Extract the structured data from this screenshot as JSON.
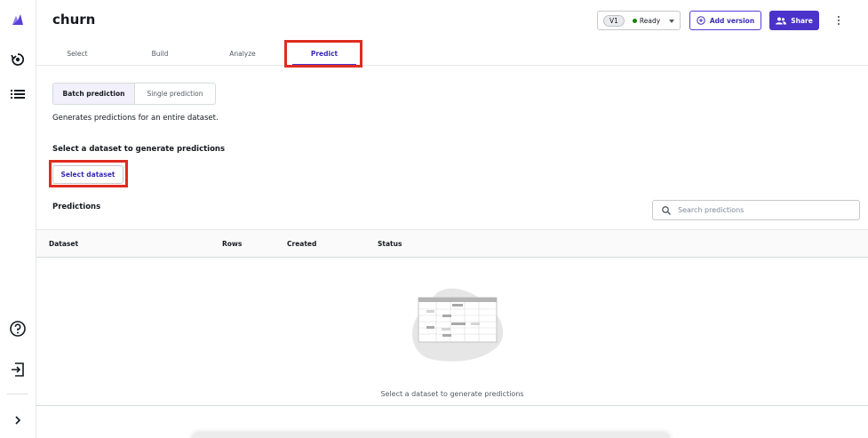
{
  "header": {
    "title": "churn",
    "version": {
      "badge": "V1",
      "status": "Ready",
      "status_color": "#1d8102"
    },
    "add_version_label": "Add version",
    "share_label": "Share"
  },
  "tabs": [
    {
      "label": "Select",
      "active": false
    },
    {
      "label": "Build",
      "active": false
    },
    {
      "label": "Analyze",
      "active": false
    },
    {
      "label": "Predict",
      "active": true
    }
  ],
  "predict": {
    "modes": [
      "Batch prediction",
      "Single prediction"
    ],
    "selected_mode": "Batch prediction",
    "description": "Generates predictions for an entire dataset.",
    "dataset_heading": "Select a dataset to generate predictions",
    "select_dataset_label": "Select dataset"
  },
  "predictions": {
    "title": "Predictions",
    "search_placeholder": "Search predictions",
    "columns": [
      "Dataset",
      "Rows",
      "Created",
      "Status"
    ],
    "rows": [],
    "empty_message": "Select a dataset to generate predictions"
  },
  "left_rail": {
    "icons": [
      "canvas-logo-icon",
      "model-icon",
      "list-icon",
      "help-icon",
      "sign-out-icon",
      "expand-icon"
    ]
  },
  "colors": {
    "accent": "#4b32c9",
    "highlight": "#e02b20"
  }
}
